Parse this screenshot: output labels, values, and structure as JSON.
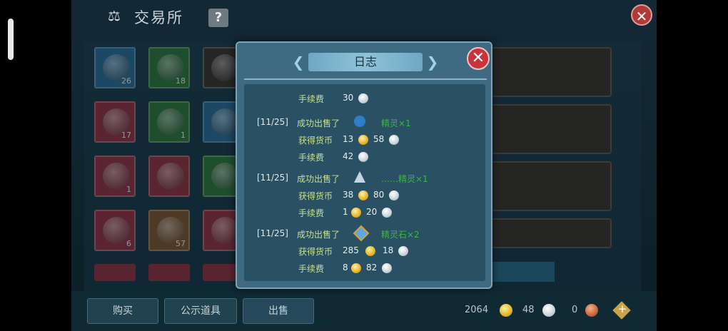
{
  "header": {
    "title": "交易所",
    "help_label": "?",
    "close_label": "✕"
  },
  "inventory": [
    {
      "count": "26",
      "color": "#2a6f9a"
    },
    {
      "count": "18",
      "color": "#2f7a45"
    },
    {
      "count": "",
      "color": "#3a3a3a"
    },
    {
      "count": "17",
      "color": "#8b3a4c"
    },
    {
      "count": "1",
      "color": "#2f7a45"
    },
    {
      "count": "",
      "color": "#2a6f9a"
    },
    {
      "count": "1",
      "color": "#8b3a4c"
    },
    {
      "count": "",
      "color": "#8b3a4c"
    },
    {
      "count": "",
      "color": "#2f7a45"
    },
    {
      "count": "6",
      "color": "#8b3a4c"
    },
    {
      "count": "57",
      "color": "#7a5a3a"
    },
    {
      "count": "",
      "color": "#8b3a4c"
    }
  ],
  "tabs": [
    {
      "label": "购买"
    },
    {
      "label": "公示道具"
    },
    {
      "label": "出售"
    }
  ],
  "currency": {
    "gold": "2064",
    "silver": "48",
    "copper": "0"
  },
  "log_dialog": {
    "title": "日志",
    "close_label": "✕",
    "entries": [
      {
        "fee_label": "手续费",
        "fee_silver": "30"
      },
      {
        "date": "[11/25]",
        "action": "成功出售了",
        "item": "精灵×1",
        "earn_label": "获得货币",
        "earn_gold": "13",
        "earn_silver": "58",
        "fee_label": "手续费",
        "fee_silver": "42"
      },
      {
        "date": "[11/25]",
        "action": "成功出售了",
        "item": "……精灵×1",
        "earn_label": "获得货币",
        "earn_gold": "38",
        "earn_silver": "80",
        "fee_label": "手续费",
        "fee_gold": "1",
        "fee_silver": "20"
      },
      {
        "date": "[11/25]",
        "action": "成功出售了",
        "item": "精灵石×2",
        "earn_label": "获得货币",
        "earn_gold": "285",
        "earn_silver": "18",
        "fee_label": "手续费",
        "fee_gold": "8",
        "fee_silver": "82"
      }
    ]
  }
}
